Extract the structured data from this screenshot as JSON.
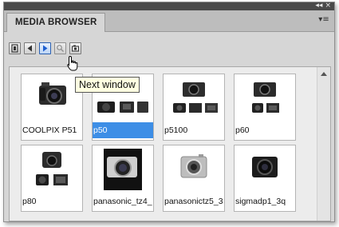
{
  "panel": {
    "title": "MEDIA BROWSER",
    "window_buttons": [
      "◂◂",
      "×"
    ],
    "menu_icon": "flyout-menu-icon"
  },
  "toolbar": {
    "buttons": [
      {
        "name": "filmstrip-view-icon"
      },
      {
        "name": "previous-window-icon"
      },
      {
        "name": "next-window-icon"
      },
      {
        "name": "search-icon"
      },
      {
        "name": "settings-icon"
      }
    ]
  },
  "tooltip": "Next window",
  "items": [
    {
      "label": "COOLPIX P51",
      "selected": false
    },
    {
      "label": "p50",
      "selected": true
    },
    {
      "label": "p5100",
      "selected": false
    },
    {
      "label": "p60",
      "selected": false
    },
    {
      "label": "p80",
      "selected": false
    },
    {
      "label": "panasonic_tz4_",
      "selected": false
    },
    {
      "label": "panasonictz5_3",
      "selected": false
    },
    {
      "label": "sigmadp1_3q",
      "selected": false
    }
  ],
  "colors": {
    "selection": "#3d8ee6",
    "tooltip_bg": "#ffffe1",
    "titlebar": "#4a4a4a"
  }
}
